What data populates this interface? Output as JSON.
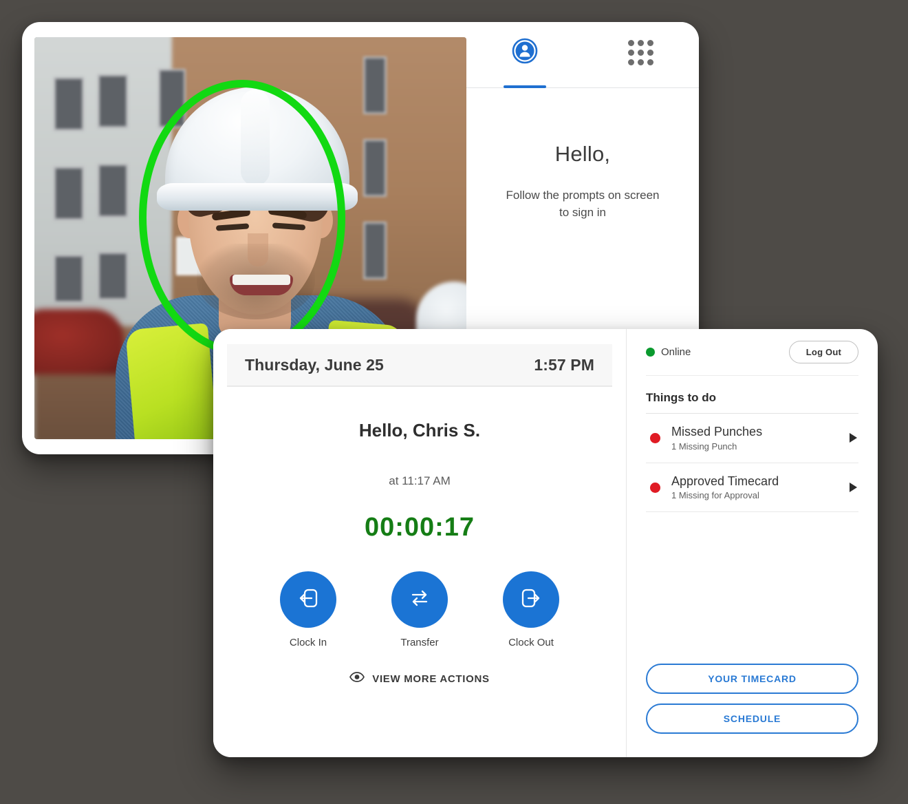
{
  "kiosk": {
    "tabs": [
      {
        "name": "person-tab",
        "icon": "person-circle-icon",
        "active": true
      },
      {
        "name": "keypad-tab",
        "icon": "grid-dots-icon",
        "active": false
      }
    ],
    "greeting": "Hello,",
    "subtitle_line1": "Follow the prompts on screen",
    "subtitle_line2": "to sign in",
    "face_capture": {
      "overlay_shape": "oval",
      "overlay_color": "#12d912",
      "status": "face-detected"
    }
  },
  "clock": {
    "date": "Thursday, June 25",
    "time": "1:57 PM",
    "greeting": "Hello, Chris S.",
    "since_label": "at 11:17 AM",
    "elapsed": "00:00:17",
    "elapsed_color": "#157d15",
    "actions": [
      {
        "label": "Clock In",
        "icon": "clock-in-icon"
      },
      {
        "label": "Transfer",
        "icon": "transfer-arrows-icon"
      },
      {
        "label": "Clock Out",
        "icon": "clock-out-icon"
      }
    ],
    "view_more_label": "VIEW MORE ACTIONS",
    "view_more_icon": "eye-icon"
  },
  "panel": {
    "status_text": "Online",
    "status_color": "#0a9a2e",
    "logout_label": "Log Out",
    "todo_title": "Things to do",
    "todos": [
      {
        "name": "Missed Punches",
        "sub": "1 Missing Punch",
        "dot_color": "#e01b24"
      },
      {
        "name": "Approved Timecard",
        "sub": "1 Missing for Approval",
        "dot_color": "#e01b24"
      }
    ],
    "buttons": [
      {
        "label": "YOUR TIMECARD"
      },
      {
        "label": "SCHEDULE"
      }
    ]
  },
  "theme": {
    "background": "#4e4b47",
    "accent_blue": "#1b74d4",
    "outline_blue": "#2a7ad4"
  }
}
